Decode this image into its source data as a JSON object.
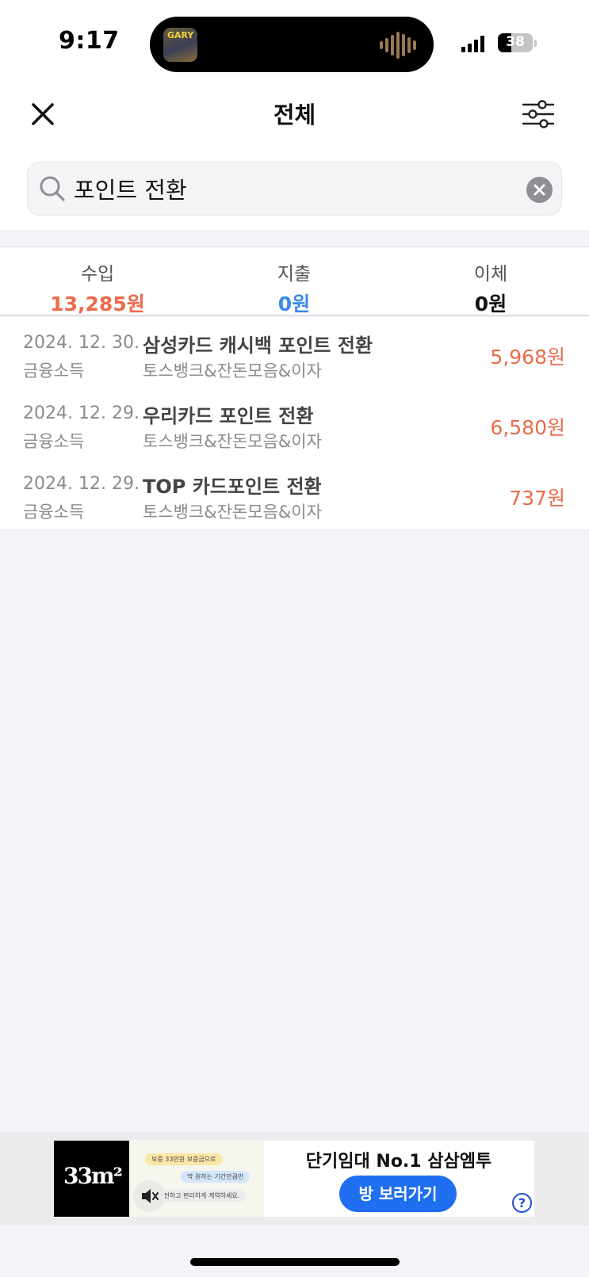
{
  "status_bar": {
    "time": "9:17",
    "album_art_text": "GARY",
    "battery_level": "38",
    "battery_fraction": 0.38
  },
  "header": {
    "title": "전체"
  },
  "search": {
    "value": "포인트 전환"
  },
  "summary": {
    "income": {
      "label": "수입",
      "value": "13,285원",
      "color": "#ec6b4a"
    },
    "expense": {
      "label": "지출",
      "value": "0원",
      "color": "#3b8be8"
    },
    "transfer": {
      "label": "이체",
      "value": "0원",
      "color": "#111111"
    }
  },
  "transactions": [
    {
      "date": "2024. 12. 30.",
      "category": "금융소득",
      "title": "삼성카드 캐시백 포인트 전환",
      "account": "토스뱅크&잔돈모음&이자",
      "amount": "5,968원"
    },
    {
      "date": "2024. 12. 29.",
      "category": "금융소득",
      "title": "우리카드 포인트 전환",
      "account": "토스뱅크&잔돈모음&이자",
      "amount": "6,580원"
    },
    {
      "date": "2024. 12. 29.",
      "category": "금융소득",
      "title": "TOP 카드포인트 전환",
      "account": "토스뱅크&잔돈모음&이자",
      "amount": "737원"
    }
  ],
  "ad": {
    "logo_text": "33m²",
    "headline": "단기임대 No.1 삼삼엠투",
    "cta_label": "방 보러가기",
    "help_symbol": "?",
    "chips": [
      "보증 33만원 보증금으로",
      "딱 원하는 기간만큼만",
      "안전하고 편리하게 계약하세요."
    ]
  },
  "colors": {
    "accent_income": "#ec6b4a",
    "accent_expense": "#3b8be8",
    "cta_blue": "#1f6ff0",
    "background": "#f3f3f8"
  },
  "icons": {
    "close": "close-icon",
    "filter": "sliders-icon",
    "search": "search-icon",
    "clear": "clear-icon",
    "mute": "mute-icon"
  }
}
